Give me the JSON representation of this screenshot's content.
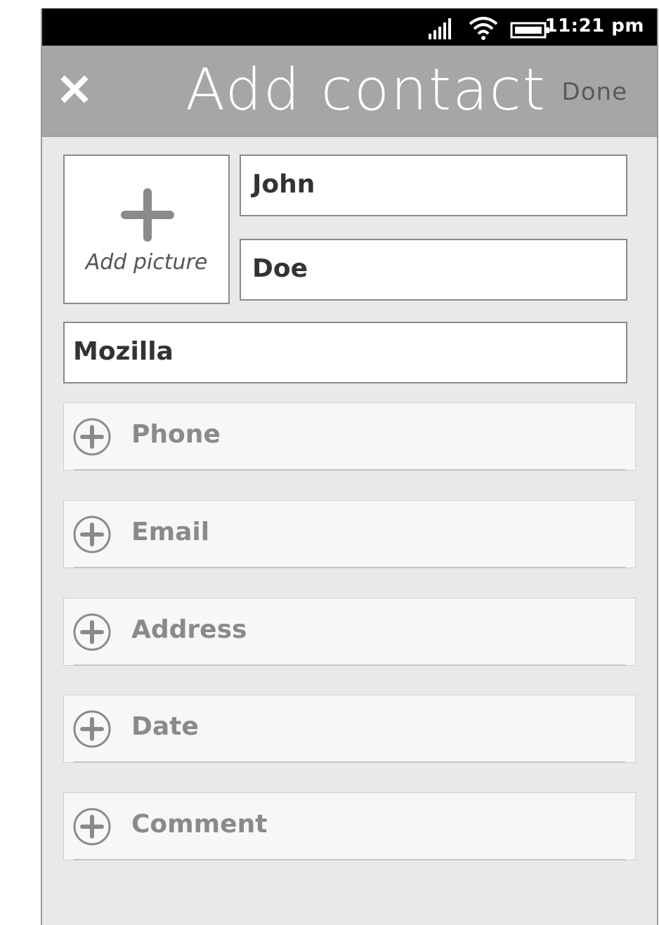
{
  "status_bar": {
    "time": "11:21 pm",
    "icons": [
      "signal-icon",
      "wifi-icon",
      "battery-icon"
    ]
  },
  "header": {
    "title": "Add contact",
    "close_icon": "close-icon",
    "done_label": "Done"
  },
  "picture": {
    "label": "Add picture",
    "icon": "plus-icon"
  },
  "fields": {
    "first_name": "John",
    "last_name": "Doe",
    "company": "Mozilla"
  },
  "add_rows": [
    {
      "label": "Phone"
    },
    {
      "label": "Email"
    },
    {
      "label": "Address"
    },
    {
      "label": "Date"
    },
    {
      "label": "Comment"
    }
  ],
  "colors": {
    "header_bg": "#a6a6a6",
    "status_bg": "#000000",
    "body_bg": "#e9e9e9",
    "row_bg": "#f7f7f7",
    "muted_text": "#8a8a8a",
    "field_text": "#333333"
  }
}
